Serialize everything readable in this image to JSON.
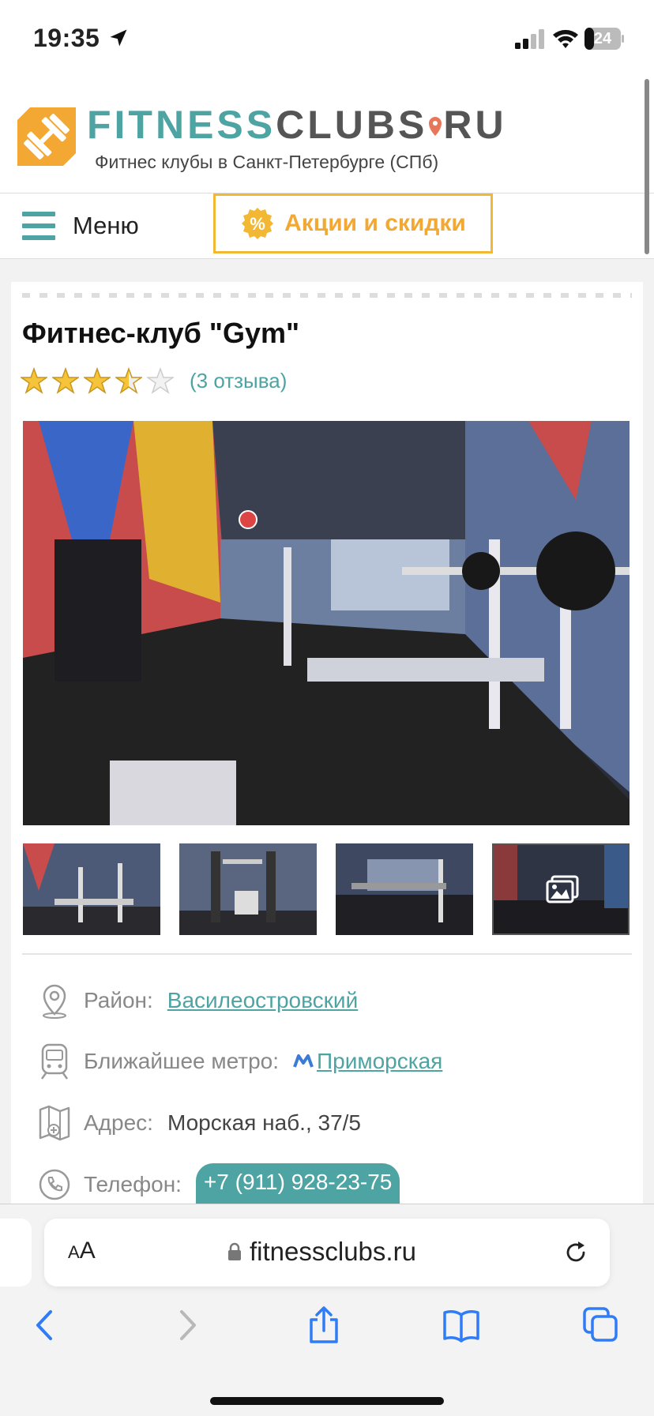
{
  "status": {
    "time": "19:35",
    "battery": "24"
  },
  "header": {
    "logo_part1": "FITNESS",
    "logo_part2": "CLUBS",
    "logo_part3": "RU",
    "subtitle": "Фитнес клубы в Санкт-Петербурге (СПб)"
  },
  "nav": {
    "menu_label": "Меню",
    "promo_label": "Акции и скидки"
  },
  "club": {
    "title": "Фитнес-клуб \"Gym\"",
    "rating": 3.5,
    "rating_max": 5,
    "reviews": "(3 отзыва)",
    "district_label": "Район:",
    "district": "Василеостровский",
    "metro_label": "Ближайшее метро:",
    "metro": "Приморская",
    "address_label": "Адрес:",
    "address": "Морская наб., 37/5",
    "phone_label": "Телефон:",
    "phone": "+7 (911) 928-23-75"
  },
  "browser": {
    "aa_label": "AA",
    "url": "fitnessclubs.ru"
  },
  "colors": {
    "accent": "#4ea3a3",
    "promo": "#f2b733",
    "logo_orange": "#f2a833"
  }
}
